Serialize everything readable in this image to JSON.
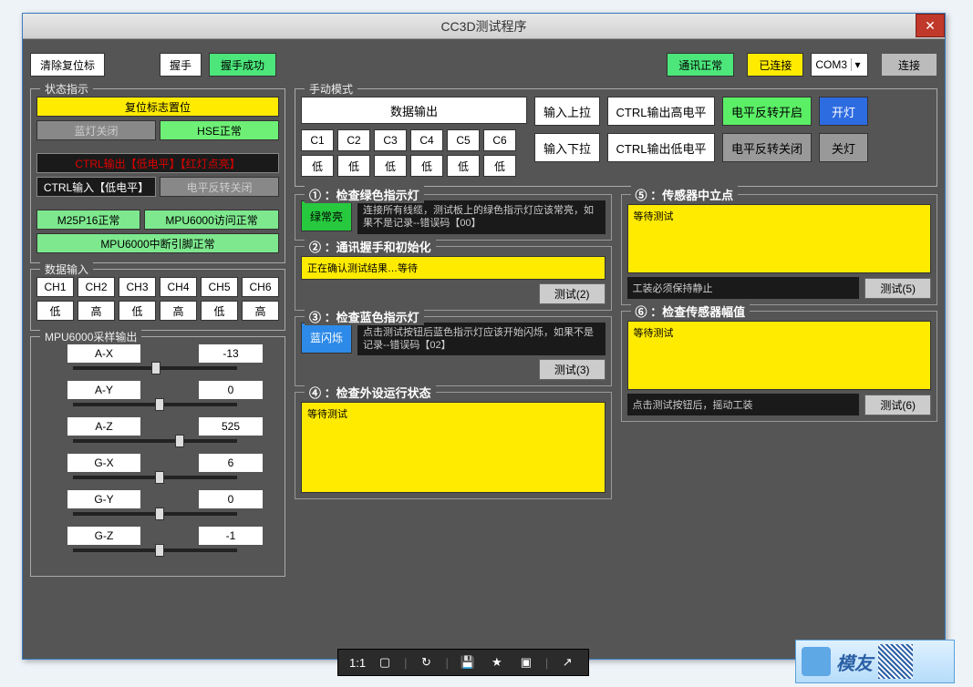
{
  "window": {
    "title": "CC3D测试程序"
  },
  "topbar": {
    "clear_reset": "清除复位标",
    "handshake": "握手",
    "hs_ok": "握手成功",
    "comm_ok": "通讯正常",
    "connected": "已连接",
    "port": "COM3",
    "port_dd": "▾",
    "connect": "连接"
  },
  "status_panel": {
    "title": "状态指示",
    "reset_flag": "复位标志置位",
    "blue_off": "蓝灯关闭",
    "hse_ok": "HSE正常",
    "ctrl_out": "CTRL输出【低电平】【红灯点亮】",
    "ctrl_in": "CTRL输入【低电平】",
    "level_inv_off": "电平反转关闭",
    "m25": "M25P16正常",
    "mpu_access": "MPU6000访问正常",
    "mpu_int": "MPU6000中断引脚正常"
  },
  "data_in": {
    "title": "数据输入",
    "ch": [
      "CH1",
      "CH2",
      "CH3",
      "CH4",
      "CH5",
      "CH6"
    ],
    "vals": [
      "低",
      "高",
      "低",
      "高",
      "低",
      "高"
    ]
  },
  "mpu_panel": {
    "title": "MPU6000采样输出",
    "rows": [
      {
        "label": "A-X",
        "value": "-13",
        "pos": 48
      },
      {
        "label": "A-Y",
        "value": "0",
        "pos": 50
      },
      {
        "label": "A-Z",
        "value": "525",
        "pos": 62
      },
      {
        "label": "G-X",
        "value": "6",
        "pos": 50
      },
      {
        "label": "G-Y",
        "value": "0",
        "pos": 50
      },
      {
        "label": "G-Z",
        "value": "-1",
        "pos": 50
      }
    ]
  },
  "manual": {
    "title": "手动模式",
    "data_out": "数据输出",
    "c": [
      "C1",
      "C2",
      "C3",
      "C4",
      "C5",
      "C6"
    ],
    "lo": "低",
    "in_pu": "输入上拉",
    "in_pd": "输入下拉",
    "ctrl_hi": "CTRL输出高电平",
    "ctrl_lo": "CTRL输出低电平",
    "lv_on": "电平反转开启",
    "lv_off": "电平反转关闭",
    "light_on": "开灯",
    "light_off": "关灯"
  },
  "step1": {
    "title": "① ：检查绿色指示灯",
    "tag": "绿常亮",
    "desc": "连接所有线缆，测试板上的绿色指示灯应该常亮，如果不是记录--错误码【00】"
  },
  "step2": {
    "title": "② ：通讯握手和初始化",
    "result": "正在确认测试结果…等待",
    "btn": "测试(2)"
  },
  "step3": {
    "title": "③ ：检查蓝色指示灯",
    "tag": "蓝闪烁",
    "desc": "点击测试按钮后蓝色指示灯应该开始闪烁，如果不是记录--错误码【02】",
    "btn": "测试(3)"
  },
  "step4": {
    "title": "④ ：检查外设运行状态",
    "result": "等待测试"
  },
  "step5": {
    "title": "⑤ ：传感器中立点",
    "result": "等待测试",
    "info": "工装必须保持静止",
    "btn": "测试(5)"
  },
  "step6": {
    "title": "⑥ ：检查传感器幅值",
    "result": "等待测试",
    "info": "点击测试按钮后，摇动工装",
    "btn": "测试(6)"
  },
  "bt": {
    "ratio": "1:1"
  },
  "logo": {
    "text": "模友"
  }
}
